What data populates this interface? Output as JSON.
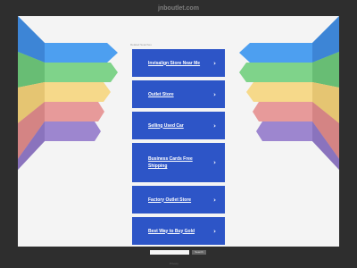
{
  "site": {
    "title": "jnboutlet.com"
  },
  "main": {
    "sponsored_label": "Related Searches",
    "links": [
      {
        "label": "Invisalign Store Near Me"
      },
      {
        "label": "Outlet Store"
      },
      {
        "label": "Selling Used Car"
      },
      {
        "label": "Business Cards Free Shipping"
      },
      {
        "label": "Factory Outlet Store"
      },
      {
        "label": "Best Way to Buy Gold"
      }
    ],
    "chevron": "›"
  },
  "footer": {
    "search_placeholder": "",
    "search_button": "Search",
    "privacy": "Privacy"
  },
  "colors": {
    "page_bg": "#2e2e2e",
    "frame_bg": "#f4f4f4",
    "link_bg": "#2d55c7",
    "stripe_blue": "#4d9ff0",
    "stripe_green": "#7fd38a",
    "stripe_yellow": "#f6d98a",
    "stripe_red": "#e79a9a",
    "stripe_purple": "#9d86cf"
  }
}
